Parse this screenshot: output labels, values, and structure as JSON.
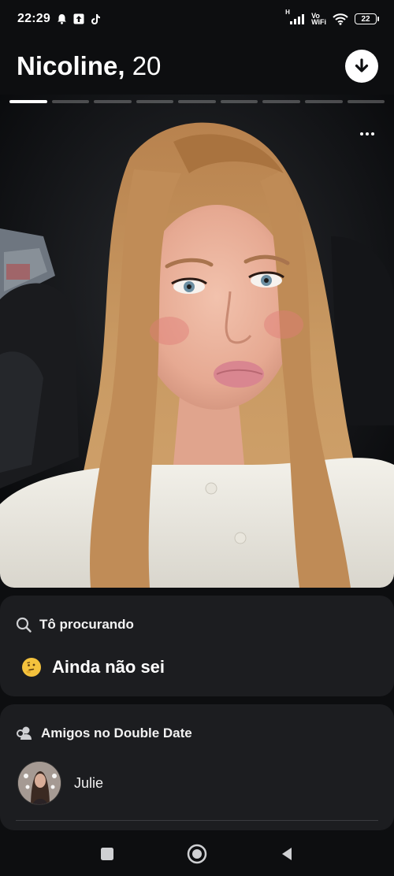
{
  "status_bar": {
    "time": "22:29",
    "network_h": "H",
    "vowifi_line1": "Vo",
    "vowifi_line2": "WiFi",
    "battery": "22"
  },
  "header": {
    "name": "Nicoline,",
    "age": " 20"
  },
  "photo": {
    "total_photos": 9,
    "current_photo": 1
  },
  "looking_for": {
    "title": "Tô procurando",
    "emoji": "thinking-face",
    "value": "Ainda não sei"
  },
  "double_date": {
    "title": "Amigos no Double Date",
    "friends": [
      {
        "name": "Julie"
      }
    ]
  },
  "colors": {
    "background": "#0d0e10",
    "card": "#1c1d20",
    "text": "#ffffff",
    "accent_emoji": "#f4c23d"
  }
}
